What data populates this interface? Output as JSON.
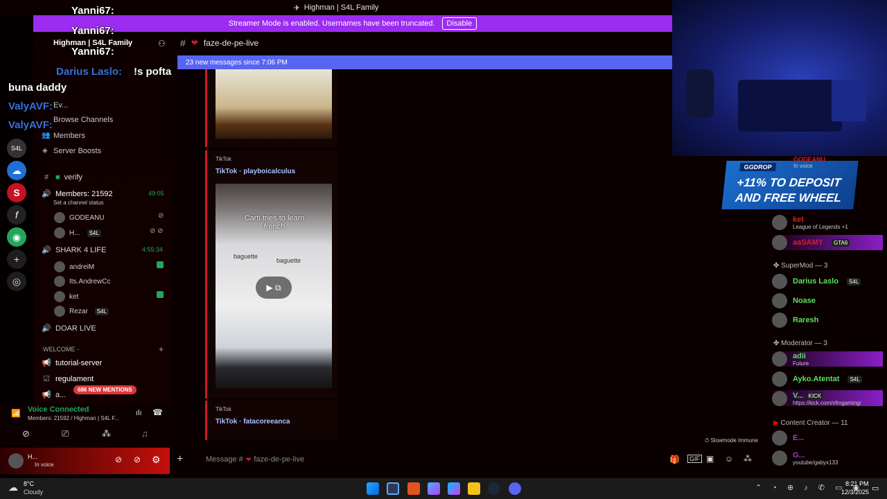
{
  "window": {
    "title": "Highman | S4L Family"
  },
  "banner": {
    "text": "Streamer Mode is enabled. Usernames have been truncated.",
    "button": "Disable"
  },
  "overlay_chat": [
    {
      "user": "Yanni67:",
      "color": "#ffffff"
    },
    {
      "user": "Yanni67:",
      "color": "#ffffff"
    },
    {
      "user": "Yanni67:",
      "color": "#ffffff"
    },
    {
      "user": "Darius Laslo:",
      "msg": "!s pofta",
      "color": "#3b6fd8"
    },
    {
      "msg2": "buna daddy"
    },
    {
      "user": "ValyAVF:",
      "color": "#3b6fd8"
    },
    {
      "user": "ValyAVF:",
      "color": "#3b6fd8"
    }
  ],
  "server": {
    "name": "Highman | S4L Family"
  },
  "sidebar": {
    "menu": [
      {
        "label": "Ev..."
      },
      {
        "label": "Browse Channels"
      },
      {
        "label": "Members"
      },
      {
        "label": "Server Boosts"
      }
    ],
    "text_channels": [
      {
        "label": "verify"
      }
    ],
    "voice_channels": [
      {
        "label": "Members: 21592",
        "time": "49:05",
        "status": "Set a channel status"
      },
      {
        "label": "SHARK 4 LIFE",
        "time": "4:55:34"
      },
      {
        "label": "DOAR LIVE"
      }
    ],
    "voice_users_1": [
      {
        "name": "GODEANU"
      },
      {
        "name": "H...",
        "tag": "S4L"
      }
    ],
    "voice_users_2": [
      {
        "name": "andreiM"
      },
      {
        "name": "Its.AndrewCc"
      },
      {
        "name": "ket"
      },
      {
        "name": "Rezar",
        "tag": "S4L"
      }
    ],
    "category": "WELCOME -",
    "welcome_channels": [
      {
        "label": "tutorial-server"
      },
      {
        "label": "regulament"
      },
      {
        "label": "a..."
      }
    ],
    "mentions_badge": "686 NEW MENTIONS"
  },
  "voice": {
    "status": "Voice Connected",
    "location": "Members: 21592 / Highman | S4L F..."
  },
  "user": {
    "name": "H...",
    "status": "In voice"
  },
  "channel": {
    "name": "faze-de-pe-live",
    "new_messages": "23 new messages since 7:06 PM",
    "slowmode": "Slowmode Immune",
    "composer_placeholder": "Message #",
    "composer_channel": "faze-de-pe-live"
  },
  "embeds": [
    {
      "provider": "TikTok",
      "title": "TikTok · playboicalculus",
      "caption": "Carti tries to learn french",
      "words": [
        "baguette",
        "baguette"
      ]
    },
    {
      "provider": "TikTok",
      "title": "TikTok · fatacoreeanca"
    }
  ],
  "ad": {
    "tag": "GGDROP",
    "line1": "+11% TO DEPOSIT",
    "line2": "AND FREE WHEEL"
  },
  "members": {
    "top_rows": [
      {
        "name": "GODEANU",
        "sub": "In voice",
        "color": "#d21f2f"
      },
      {
        "name": "ket",
        "sub": "League of Legends +1",
        "color": "#d21f2f"
      },
      {
        "name": "aaSAMY",
        "tag": "GTA6",
        "color": "#d21f2f"
      }
    ],
    "supermod": {
      "label": "SuperMod — 3",
      "rows": [
        {
          "name": "Darius Laslo",
          "tag": "S4L",
          "color": "#5ce05c"
        },
        {
          "name": "Noase",
          "color": "#5ce05c"
        },
        {
          "name": "Raresh",
          "color": "#5ce05c"
        }
      ]
    },
    "moderator": {
      "label": "Moderator — 3",
      "rows": [
        {
          "name": "adii",
          "sub": "Future",
          "color": "#5ce05c"
        },
        {
          "name": "Ayko.Atentat",
          "tag": "S4L",
          "color": "#5ce05c"
        },
        {
          "name": "V...",
          "tag": "KICK",
          "sub": "https://kick.com/vfmgaming/",
          "color": "#5ce05c"
        }
      ]
    },
    "content_creator": {
      "label": "Content Creator — 11",
      "rows": [
        {
          "name": "E...",
          "color": "#a23ccf"
        },
        {
          "name": "G...",
          "sub": "youtube/gabyx133",
          "color": "#a23ccf"
        }
      ]
    }
  },
  "taskbar": {
    "weather_temp": "8°C",
    "weather_desc": "Cloudy",
    "time": "8:21 PM",
    "date": "12/3/2025"
  },
  "colors": {
    "accent": "#5865f2",
    "red": "#d11a2a",
    "purple": "#9b2cf0"
  }
}
